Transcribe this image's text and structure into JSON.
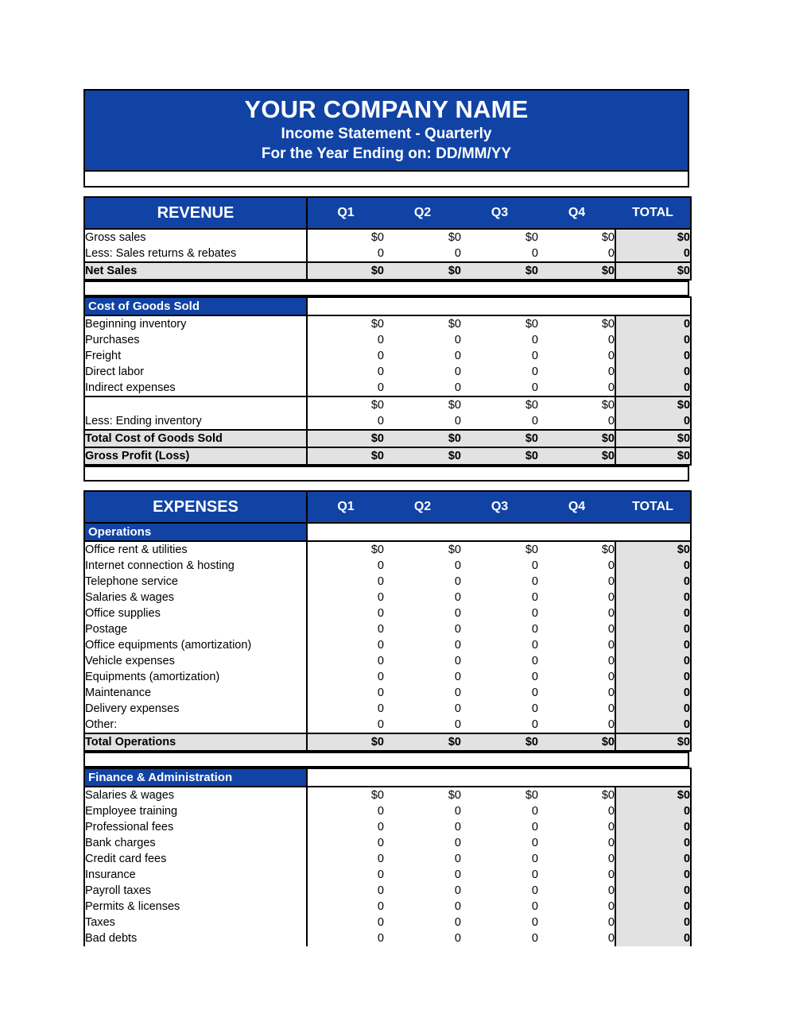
{
  "document": {
    "company_name": "YOUR COMPANY NAME",
    "statement_title": "Income Statement - Quarterly",
    "period_line": "For the Year Ending on: DD/MM/YY"
  },
  "colors": {
    "header_blue": "#1143A5",
    "total_grey": "#e2e2e2",
    "header_text": "#ffffff",
    "border": "#000000"
  },
  "columns": {
    "q1": "Q1",
    "q2": "Q2",
    "q3": "Q3",
    "q4": "Q4",
    "total": "TOTAL"
  },
  "revenue": {
    "section_label": "REVENUE",
    "rows": [
      {
        "label": "Gross sales",
        "q1": "$0",
        "q2": "$0",
        "q3": "$0",
        "q4": "$0",
        "total": "$0"
      },
      {
        "label": "Less: Sales returns & rebates",
        "q1": "0",
        "q2": "0",
        "q3": "0",
        "q4": "0",
        "total": "0"
      }
    ],
    "net_sales": {
      "label": "Net Sales",
      "q1": "$0",
      "q2": "$0",
      "q3": "$0",
      "q4": "$0",
      "total": "$0"
    }
  },
  "cogs": {
    "section_label": "Cost of Goods Sold",
    "rows": [
      {
        "label": "Beginning inventory",
        "q1": "$0",
        "q2": "$0",
        "q3": "$0",
        "q4": "$0",
        "total": "0"
      },
      {
        "label": "Purchases",
        "q1": "0",
        "q2": "0",
        "q3": "0",
        "q4": "0",
        "total": "0"
      },
      {
        "label": "Freight",
        "q1": "0",
        "q2": "0",
        "q3": "0",
        "q4": "0",
        "total": "0"
      },
      {
        "label": "Direct labor",
        "q1": "0",
        "q2": "0",
        "q3": "0",
        "q4": "0",
        "total": "0"
      },
      {
        "label": "Indirect expenses",
        "q1": "0",
        "q2": "0",
        "q3": "0",
        "q4": "0",
        "total": "0"
      }
    ],
    "subtotal": {
      "label": "",
      "q1": "$0",
      "q2": "$0",
      "q3": "$0",
      "q4": "$0",
      "total": "$0"
    },
    "ending_inventory": {
      "label": "Less: Ending inventory",
      "q1": "0",
      "q2": "0",
      "q3": "0",
      "q4": "0",
      "total": "0"
    },
    "total_cogs": {
      "label": "Total Cost of Goods Sold",
      "q1": "$0",
      "q2": "$0",
      "q3": "$0",
      "q4": "$0",
      "total": "$0"
    },
    "gross_profit": {
      "label": "Gross Profit (Loss)",
      "q1": "$0",
      "q2": "$0",
      "q3": "$0",
      "q4": "$0",
      "total": "$0"
    }
  },
  "expenses": {
    "section_label": "EXPENSES",
    "operations": {
      "sub_label": "Operations",
      "rows": [
        {
          "label": "Office rent & utilities",
          "q1": "$0",
          "q2": "$0",
          "q3": "$0",
          "q4": "$0",
          "total": "$0"
        },
        {
          "label": "Internet connection & hosting",
          "q1": "0",
          "q2": "0",
          "q3": "0",
          "q4": "0",
          "total": "0"
        },
        {
          "label": "Telephone service",
          "q1": "0",
          "q2": "0",
          "q3": "0",
          "q4": "0",
          "total": "0"
        },
        {
          "label": "Salaries & wages",
          "q1": "0",
          "q2": "0",
          "q3": "0",
          "q4": "0",
          "total": "0"
        },
        {
          "label": "Office supplies",
          "q1": "0",
          "q2": "0",
          "q3": "0",
          "q4": "0",
          "total": "0"
        },
        {
          "label": "Postage",
          "q1": "0",
          "q2": "0",
          "q3": "0",
          "q4": "0",
          "total": "0"
        },
        {
          "label": "Office equipments (amortization)",
          "q1": "0",
          "q2": "0",
          "q3": "0",
          "q4": "0",
          "total": "0"
        },
        {
          "label": "Vehicle expenses",
          "q1": "0",
          "q2": "0",
          "q3": "0",
          "q4": "0",
          "total": "0"
        },
        {
          "label": "Equipments (amortization)",
          "q1": "0",
          "q2": "0",
          "q3": "0",
          "q4": "0",
          "total": "0"
        },
        {
          "label": "Maintenance",
          "q1": "0",
          "q2": "0",
          "q3": "0",
          "q4": "0",
          "total": "0"
        },
        {
          "label": "Delivery expenses",
          "q1": "0",
          "q2": "0",
          "q3": "0",
          "q4": "0",
          "total": "0"
        },
        {
          "label": "Other:",
          "q1": "0",
          "q2": "0",
          "q3": "0",
          "q4": "0",
          "total": "0"
        }
      ],
      "total": {
        "label": "Total Operations",
        "q1": "$0",
        "q2": "$0",
        "q3": "$0",
        "q4": "$0",
        "total": "$0"
      }
    },
    "finance_admin": {
      "sub_label": "Finance & Administration",
      "rows": [
        {
          "label": "Salaries & wages",
          "q1": "$0",
          "q2": "$0",
          "q3": "$0",
          "q4": "$0",
          "total": "$0"
        },
        {
          "label": "Employee training",
          "q1": "0",
          "q2": "0",
          "q3": "0",
          "q4": "0",
          "total": "0"
        },
        {
          "label": "Professional fees",
          "q1": "0",
          "q2": "0",
          "q3": "0",
          "q4": "0",
          "total": "0"
        },
        {
          "label": "Bank charges",
          "q1": "0",
          "q2": "0",
          "q3": "0",
          "q4": "0",
          "total": "0"
        },
        {
          "label": "Credit card fees",
          "q1": "0",
          "q2": "0",
          "q3": "0",
          "q4": "0",
          "total": "0"
        },
        {
          "label": "Insurance",
          "q1": "0",
          "q2": "0",
          "q3": "0",
          "q4": "0",
          "total": "0"
        },
        {
          "label": "Payroll taxes",
          "q1": "0",
          "q2": "0",
          "q3": "0",
          "q4": "0",
          "total": "0"
        },
        {
          "label": "Permits & licenses",
          "q1": "0",
          "q2": "0",
          "q3": "0",
          "q4": "0",
          "total": "0"
        },
        {
          "label": "Taxes",
          "q1": "0",
          "q2": "0",
          "q3": "0",
          "q4": "0",
          "total": "0"
        },
        {
          "label": "Bad debts",
          "q1": "0",
          "q2": "0",
          "q3": "0",
          "q4": "0",
          "total": "0"
        }
      ]
    }
  }
}
